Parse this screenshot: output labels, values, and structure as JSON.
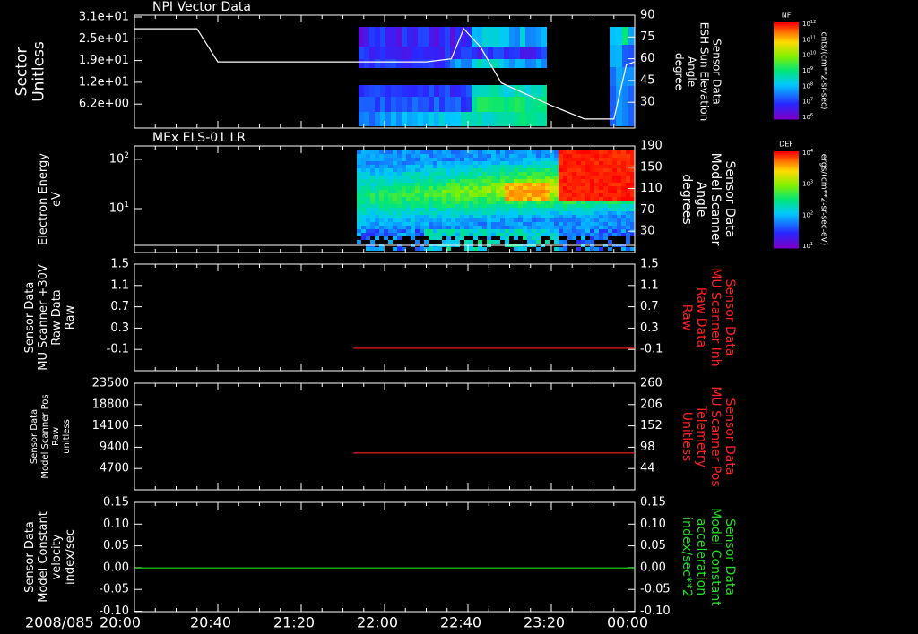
{
  "date_label": "2008/085",
  "x_ticks": [
    "20:00",
    "20:40",
    "21:20",
    "22:00",
    "22:40",
    "23:20",
    "00:00"
  ],
  "colors": {
    "background": "#000000",
    "axis": "#ffffff",
    "red_trace": "#ff2020",
    "green_trace": "#22dd22"
  },
  "chart_data": [
    {
      "type": "heatmap",
      "title": "NPI Vector Data",
      "left_axis": {
        "label_lines": [
          "Sector",
          "Unitless"
        ],
        "ticks": [
          "3.1e+01",
          "2.5e+01",
          "1.9e+01",
          "1.2e+01",
          "6.2e+00"
        ],
        "range": [
          0,
          31
        ]
      },
      "right_axis": {
        "label_lines": [
          "Sensor Data",
          "ESH Sun Elevation",
          "Angle",
          "degree"
        ],
        "ticks": [
          "90",
          "75",
          "60",
          "45",
          "30"
        ],
        "range": [
          15,
          90
        ]
      },
      "colorbar": {
        "title": "NF",
        "ticks": [
          "10^12",
          "10^11",
          "10^10",
          "10^9",
          "10^8",
          "10^7",
          "10^6"
        ],
        "unit": "cnts/(cm**2-sr-sec)"
      },
      "line_series": {
        "name": "ESH Sun Elevation Angle",
        "x": [
          "20:00",
          "20:30",
          "20:40",
          "21:00",
          "22:00",
          "22:20",
          "22:32",
          "22:38",
          "22:46",
          "22:56",
          "23:20",
          "23:36",
          "23:50",
          "23:56",
          "00:00"
        ],
        "y": [
          81,
          81,
          59,
          59,
          59,
          59,
          61,
          81,
          69,
          45,
          30,
          21,
          21,
          57,
          59
        ]
      }
    },
    {
      "type": "heatmap",
      "title": "MEx ELS-01 LR",
      "left_axis": {
        "label_lines": [
          "Electron Energy",
          "eV"
        ],
        "ticks": [
          "10^2",
          "10^1"
        ],
        "scale": "log"
      },
      "right_axis": {
        "label_lines": [
          "Sensor Data",
          "Model Scanner",
          "Angle",
          "degrees"
        ],
        "ticks": [
          "190",
          "150",
          "110",
          "70",
          "30"
        ],
        "range": [
          0,
          190
        ]
      },
      "colorbar": {
        "title": "DEF",
        "ticks": [
          "10^4",
          "10^3",
          "10^2",
          "10^1"
        ],
        "unit": "ergs/(cm**2-sr-sec-eV)"
      }
    },
    {
      "type": "line",
      "left_axis": {
        "label_lines": [
          "Sensor Data",
          "MU Scanner +30V",
          "Raw Data",
          "Raw"
        ],
        "ticks": [
          "1.5",
          "1.1",
          "0.7",
          "0.3",
          "-0.1"
        ],
        "range": [
          -0.4,
          1.5
        ]
      },
      "right_axis": {
        "label_lines": [
          "Sensor Data",
          "MU Scanner Inh",
          "Raw Data",
          "Raw"
        ],
        "ticks": [
          "1.5",
          "1.1",
          "0.7",
          "0.3",
          "-0.1"
        ],
        "range": [
          -0.4,
          1.5
        ]
      },
      "series": [
        {
          "name": "MU Scanner Inh Raw Data",
          "x": [
            "21:45",
            "00:00"
          ],
          "y": [
            0,
            0
          ]
        }
      ]
    },
    {
      "type": "line",
      "left_axis": {
        "label_lines": [
          "Sensor Data",
          "Model Scanner Pos",
          "Raw",
          "unitless"
        ],
        "ticks": [
          "23500",
          "18800",
          "14100",
          "9400",
          "4700"
        ],
        "range": [
          0,
          23500
        ]
      },
      "right_axis": {
        "label_lines": [
          "Sensor Data",
          "MU Scanner Pos",
          "Telemetry",
          "Unitless"
        ],
        "ticks": [
          "260",
          "206",
          "152",
          "98",
          "44"
        ],
        "range": [
          0,
          260
        ]
      },
      "series": [
        {
          "name": "MU Scanner Pos Telemetry",
          "x": [
            "21:45",
            "00:00"
          ],
          "y": [
            90,
            90
          ]
        }
      ]
    },
    {
      "type": "line",
      "left_axis": {
        "label_lines": [
          "Sensor Data",
          "Model Constant",
          "velocity",
          "index/sec"
        ],
        "ticks": [
          "0.15",
          "0.10",
          "0.05",
          "0.00",
          "-0.05",
          "-0.10"
        ],
        "range": [
          -0.1,
          0.15
        ]
      },
      "right_axis": {
        "label_lines": [
          "Sensor Data",
          "Model Constant",
          "acceleration",
          "index/sec**2"
        ],
        "ticks": [
          "0.15",
          "0.10",
          "0.05",
          "0.00",
          "-0.05",
          "-0.10"
        ],
        "range": [
          -0.1,
          0.15
        ]
      },
      "series": [
        {
          "name": "Model Constant acceleration",
          "x": [
            "20:00",
            "00:00"
          ],
          "y": [
            0,
            0
          ]
        }
      ]
    }
  ]
}
